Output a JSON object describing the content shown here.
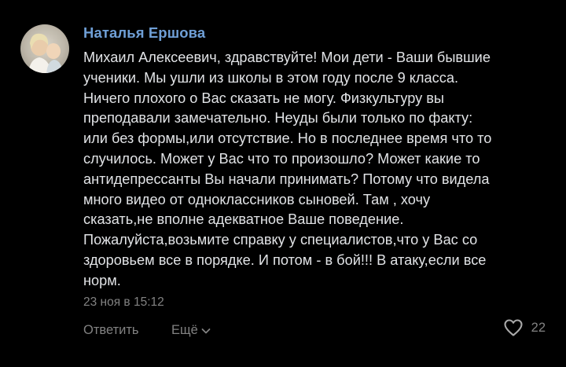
{
  "comment": {
    "author": "Наталья Ершова",
    "text": "Михаил Алексеевич, здравствуйте! Мои дети - Ваши бывшие\nученики. Мы ушли из школы в этом году после 9 класса.\nНичего плохого о Вас сказать не могу. Физкультуру вы\nпреподавали замечательно. Неуды были только по факту:\nили без формы,или отсутствие. Но в последнее время что то\nслучилось. Может у Вас что то произошло? Может какие то\nантидепрессанты Вы начали принимать? Потому что видела\nмного видео от одноклассников сыновей. Там , хочу\nсказать,не вполне адекватное Ваше поведение.\nПожалуйста,возьмите справку у специалистов,что у Вас со\nздоровьем все в порядке. И потом - в бой!!! В атаку,если все\nнорм.",
    "timestamp": "23 ноя в 15:12",
    "reply_label": "Ответить",
    "more_label": "Ещё",
    "like_count": "22"
  },
  "icons": {
    "more": "chevron-down-icon",
    "like": "heart-icon"
  },
  "colors": {
    "background": "#000000",
    "author": "#6f9fd6",
    "text": "#e1e3e6",
    "secondary": "#828282"
  }
}
